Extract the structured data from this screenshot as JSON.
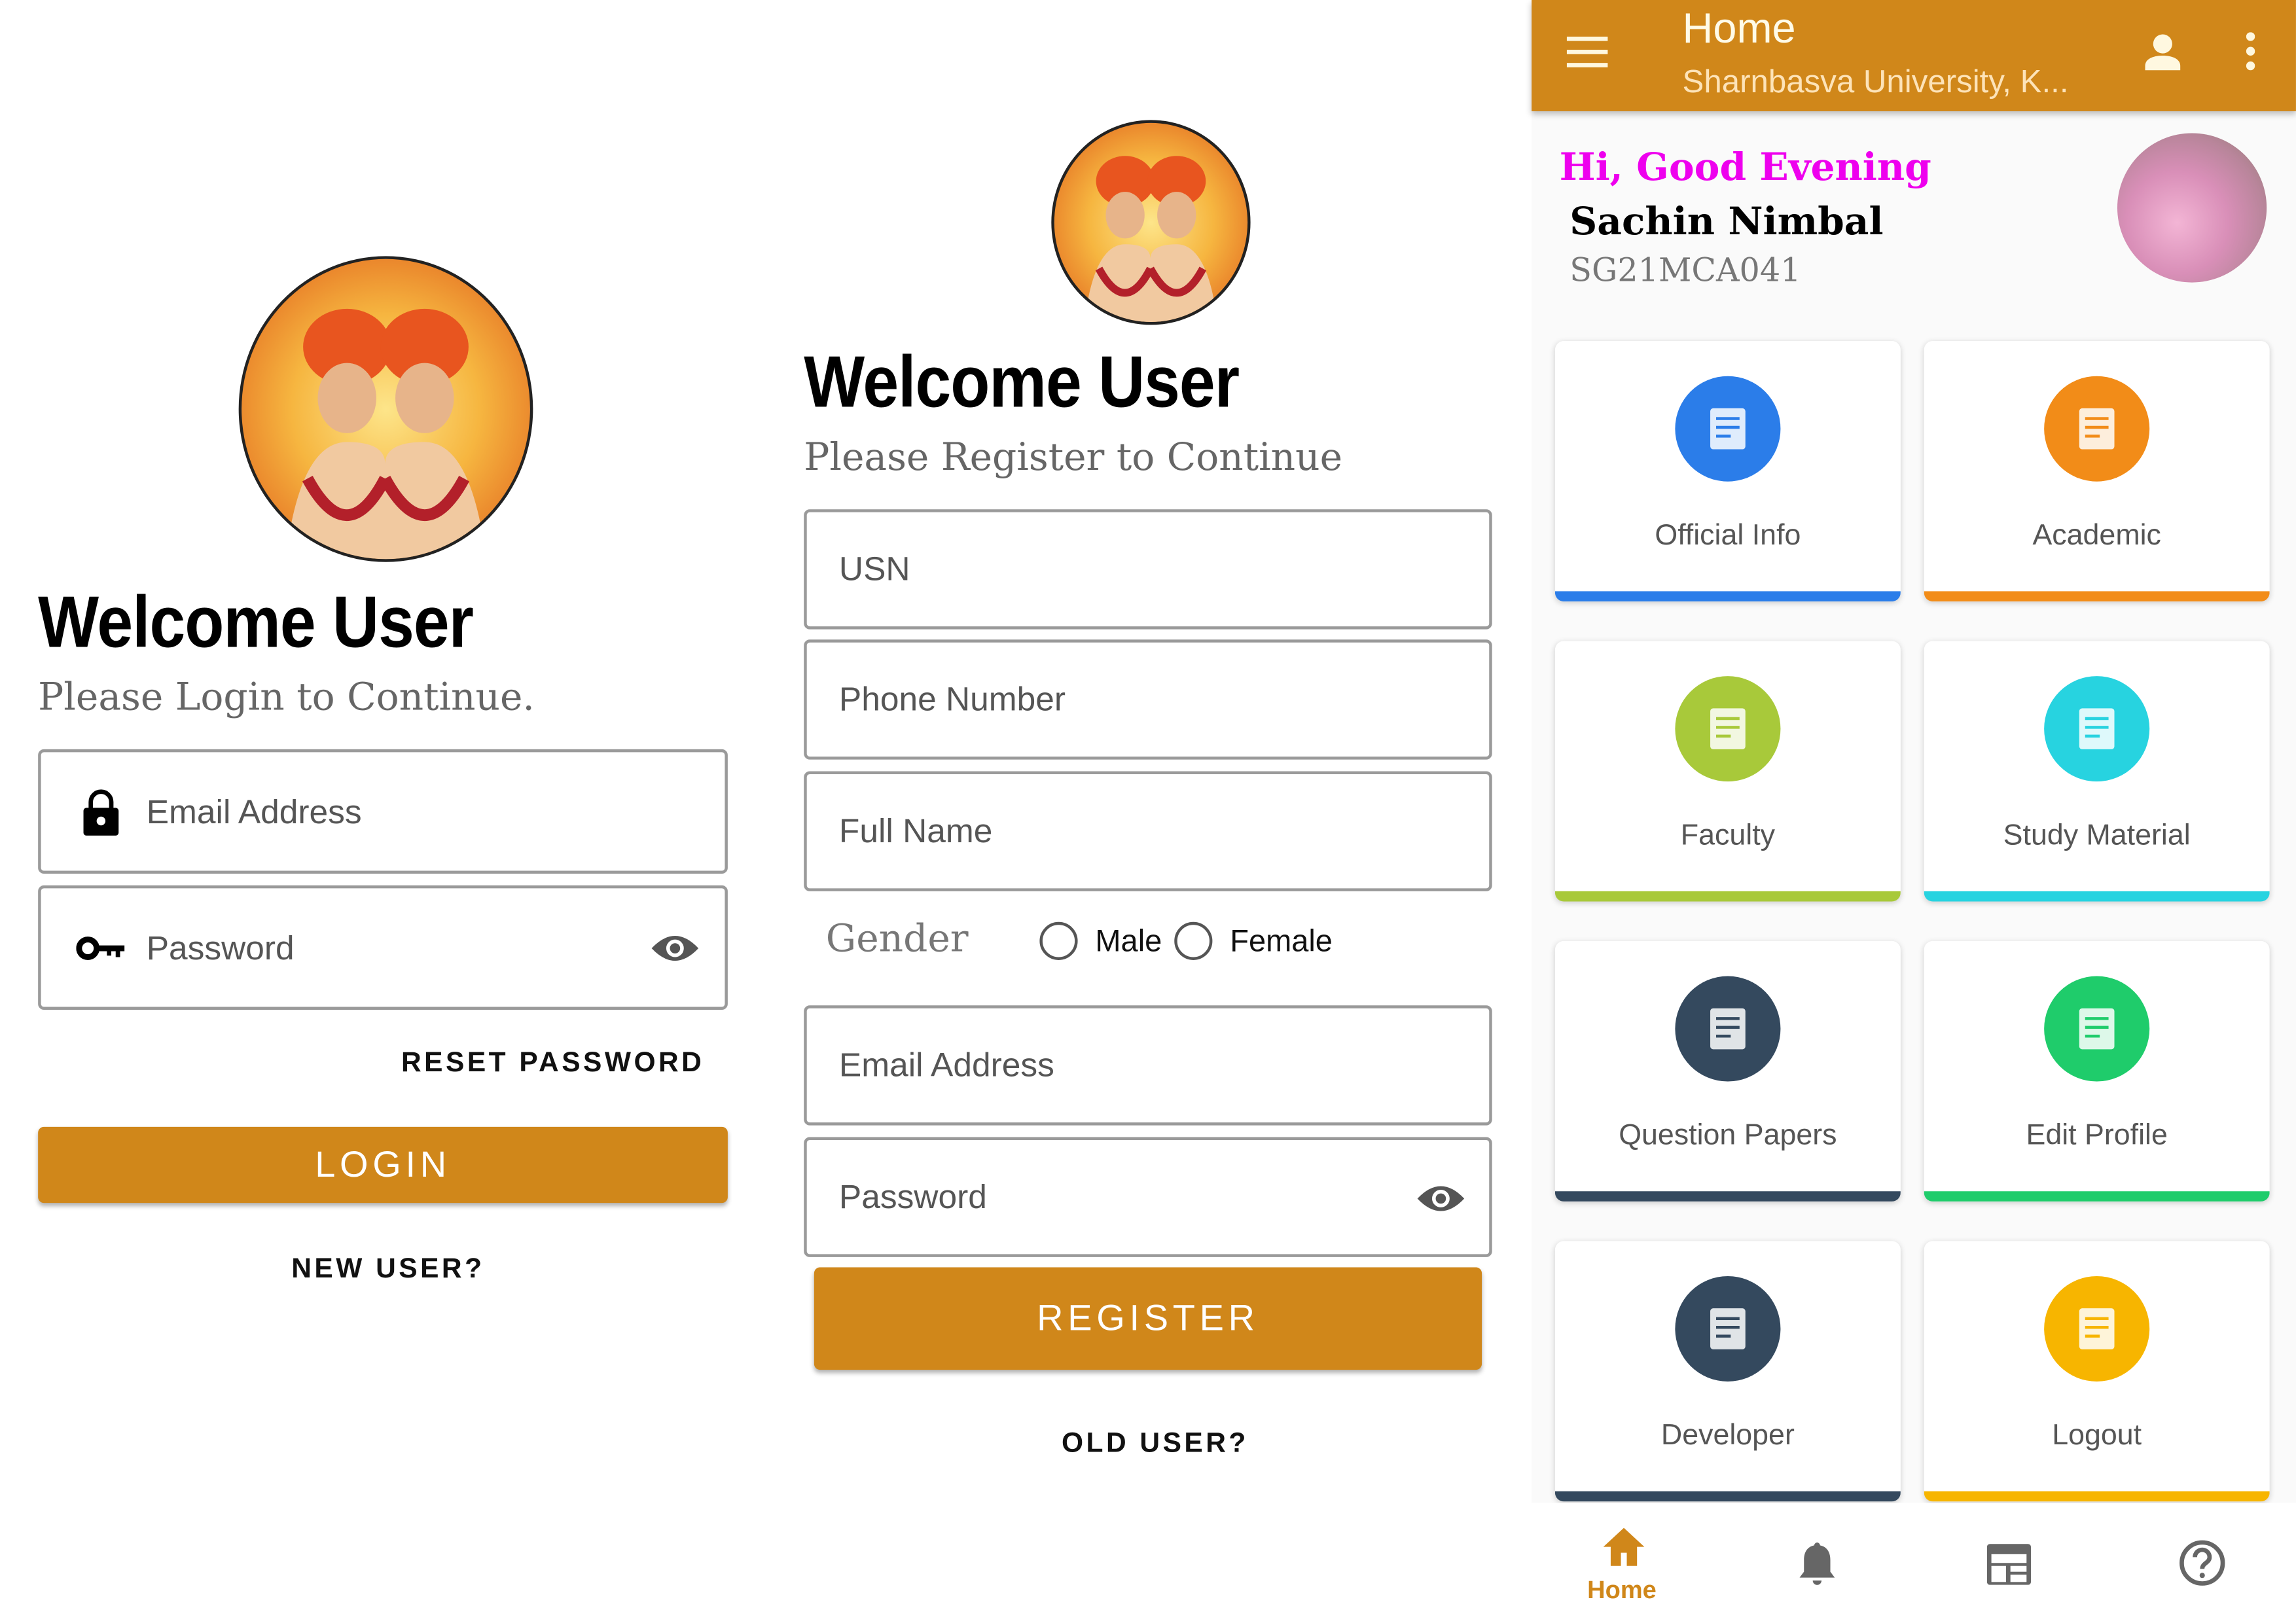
{
  "login": {
    "title": "Welcome User",
    "subtitle": "Please Login to Continue.",
    "email_placeholder": "Email Address",
    "password_placeholder": "Password",
    "reset_label": "RESET PASSWORD",
    "login_label": "LOGIN",
    "new_user_label": "NEW USER?"
  },
  "register": {
    "title": "Welcome User",
    "subtitle": "Please Register to Continue",
    "usn_placeholder": "USN",
    "phone_placeholder": "Phone Number",
    "name_placeholder": "Full Name",
    "gender_label": "Gender",
    "gender_options": [
      "Male",
      "Female"
    ],
    "email_placeholder": "Email Address",
    "password_placeholder": "Password",
    "register_label": "REGISTER",
    "old_user_label": "OLD USER?"
  },
  "home": {
    "appbar": {
      "title": "Home",
      "subtitle": "Sharnbasva University, K..."
    },
    "greeting": "Hi, Good Evening",
    "user_name": "Sachin Nimbal",
    "usn": "SG21MCA041",
    "tiles": [
      {
        "label": "Official Info",
        "icon": "www-globe-icon",
        "color": "#2b7de9"
      },
      {
        "label": "Academic",
        "icon": "graduation-books-icon",
        "color": "#f28c18"
      },
      {
        "label": "Faculty",
        "icon": "teacher-board-icon",
        "color": "#a8c93a"
      },
      {
        "label": "Study Material",
        "icon": "document-hand-icon",
        "color": "#27d3e0"
      },
      {
        "label": "Question Papers",
        "icon": "paper-icon",
        "color": "#34495e"
      },
      {
        "label": "Edit Profile",
        "icon": "edit-document-icon",
        "color": "#1fcc6b"
      },
      {
        "label": "Developer",
        "icon": "developer-laptop-icon",
        "color": "#34495e"
      },
      {
        "label": "Logout",
        "icon": "exit-door-icon",
        "color": "#f7b500"
      }
    ],
    "bottom_nav": [
      {
        "label": "Home",
        "icon": "home-icon",
        "active": true
      },
      {
        "icon": "bell-icon"
      },
      {
        "icon": "calendar-table-icon"
      },
      {
        "icon": "help-circle-icon"
      }
    ],
    "accent": "#d0871a",
    "greeting_color": "#ee00ee"
  }
}
